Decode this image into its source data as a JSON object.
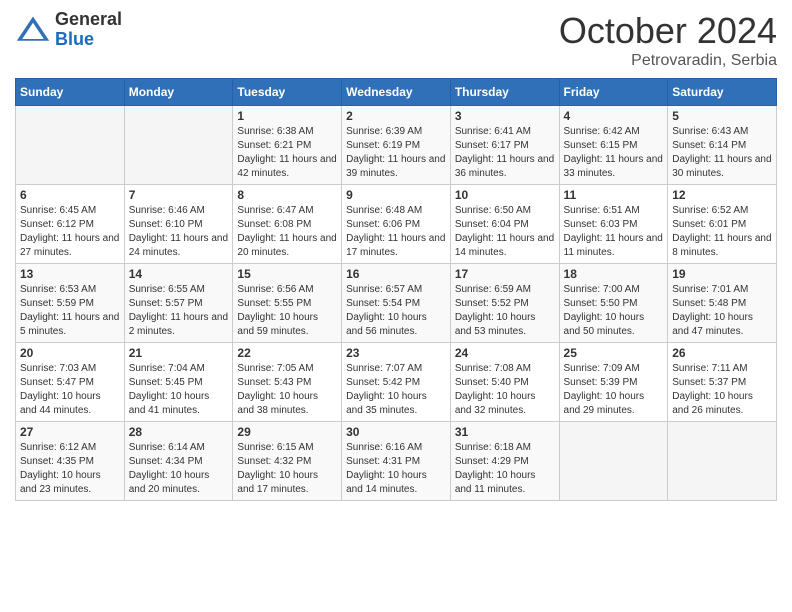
{
  "header": {
    "logo_general": "General",
    "logo_blue": "Blue",
    "month_title": "October 2024",
    "location": "Petrovaradin, Serbia"
  },
  "weekdays": [
    "Sunday",
    "Monday",
    "Tuesday",
    "Wednesday",
    "Thursday",
    "Friday",
    "Saturday"
  ],
  "weeks": [
    [
      {
        "day": "",
        "sunrise": "",
        "sunset": "",
        "daylight": ""
      },
      {
        "day": "",
        "sunrise": "",
        "sunset": "",
        "daylight": ""
      },
      {
        "day": "1",
        "sunrise": "Sunrise: 6:38 AM",
        "sunset": "Sunset: 6:21 PM",
        "daylight": "Daylight: 11 hours and 42 minutes."
      },
      {
        "day": "2",
        "sunrise": "Sunrise: 6:39 AM",
        "sunset": "Sunset: 6:19 PM",
        "daylight": "Daylight: 11 hours and 39 minutes."
      },
      {
        "day": "3",
        "sunrise": "Sunrise: 6:41 AM",
        "sunset": "Sunset: 6:17 PM",
        "daylight": "Daylight: 11 hours and 36 minutes."
      },
      {
        "day": "4",
        "sunrise": "Sunrise: 6:42 AM",
        "sunset": "Sunset: 6:15 PM",
        "daylight": "Daylight: 11 hours and 33 minutes."
      },
      {
        "day": "5",
        "sunrise": "Sunrise: 6:43 AM",
        "sunset": "Sunset: 6:14 PM",
        "daylight": "Daylight: 11 hours and 30 minutes."
      }
    ],
    [
      {
        "day": "6",
        "sunrise": "Sunrise: 6:45 AM",
        "sunset": "Sunset: 6:12 PM",
        "daylight": "Daylight: 11 hours and 27 minutes."
      },
      {
        "day": "7",
        "sunrise": "Sunrise: 6:46 AM",
        "sunset": "Sunset: 6:10 PM",
        "daylight": "Daylight: 11 hours and 24 minutes."
      },
      {
        "day": "8",
        "sunrise": "Sunrise: 6:47 AM",
        "sunset": "Sunset: 6:08 PM",
        "daylight": "Daylight: 11 hours and 20 minutes."
      },
      {
        "day": "9",
        "sunrise": "Sunrise: 6:48 AM",
        "sunset": "Sunset: 6:06 PM",
        "daylight": "Daylight: 11 hours and 17 minutes."
      },
      {
        "day": "10",
        "sunrise": "Sunrise: 6:50 AM",
        "sunset": "Sunset: 6:04 PM",
        "daylight": "Daylight: 11 hours and 14 minutes."
      },
      {
        "day": "11",
        "sunrise": "Sunrise: 6:51 AM",
        "sunset": "Sunset: 6:03 PM",
        "daylight": "Daylight: 11 hours and 11 minutes."
      },
      {
        "day": "12",
        "sunrise": "Sunrise: 6:52 AM",
        "sunset": "Sunset: 6:01 PM",
        "daylight": "Daylight: 11 hours and 8 minutes."
      }
    ],
    [
      {
        "day": "13",
        "sunrise": "Sunrise: 6:53 AM",
        "sunset": "Sunset: 5:59 PM",
        "daylight": "Daylight: 11 hours and 5 minutes."
      },
      {
        "day": "14",
        "sunrise": "Sunrise: 6:55 AM",
        "sunset": "Sunset: 5:57 PM",
        "daylight": "Daylight: 11 hours and 2 minutes."
      },
      {
        "day": "15",
        "sunrise": "Sunrise: 6:56 AM",
        "sunset": "Sunset: 5:55 PM",
        "daylight": "Daylight: 10 hours and 59 minutes."
      },
      {
        "day": "16",
        "sunrise": "Sunrise: 6:57 AM",
        "sunset": "Sunset: 5:54 PM",
        "daylight": "Daylight: 10 hours and 56 minutes."
      },
      {
        "day": "17",
        "sunrise": "Sunrise: 6:59 AM",
        "sunset": "Sunset: 5:52 PM",
        "daylight": "Daylight: 10 hours and 53 minutes."
      },
      {
        "day": "18",
        "sunrise": "Sunrise: 7:00 AM",
        "sunset": "Sunset: 5:50 PM",
        "daylight": "Daylight: 10 hours and 50 minutes."
      },
      {
        "day": "19",
        "sunrise": "Sunrise: 7:01 AM",
        "sunset": "Sunset: 5:48 PM",
        "daylight": "Daylight: 10 hours and 47 minutes."
      }
    ],
    [
      {
        "day": "20",
        "sunrise": "Sunrise: 7:03 AM",
        "sunset": "Sunset: 5:47 PM",
        "daylight": "Daylight: 10 hours and 44 minutes."
      },
      {
        "day": "21",
        "sunrise": "Sunrise: 7:04 AM",
        "sunset": "Sunset: 5:45 PM",
        "daylight": "Daylight: 10 hours and 41 minutes."
      },
      {
        "day": "22",
        "sunrise": "Sunrise: 7:05 AM",
        "sunset": "Sunset: 5:43 PM",
        "daylight": "Daylight: 10 hours and 38 minutes."
      },
      {
        "day": "23",
        "sunrise": "Sunrise: 7:07 AM",
        "sunset": "Sunset: 5:42 PM",
        "daylight": "Daylight: 10 hours and 35 minutes."
      },
      {
        "day": "24",
        "sunrise": "Sunrise: 7:08 AM",
        "sunset": "Sunset: 5:40 PM",
        "daylight": "Daylight: 10 hours and 32 minutes."
      },
      {
        "day": "25",
        "sunrise": "Sunrise: 7:09 AM",
        "sunset": "Sunset: 5:39 PM",
        "daylight": "Daylight: 10 hours and 29 minutes."
      },
      {
        "day": "26",
        "sunrise": "Sunrise: 7:11 AM",
        "sunset": "Sunset: 5:37 PM",
        "daylight": "Daylight: 10 hours and 26 minutes."
      }
    ],
    [
      {
        "day": "27",
        "sunrise": "Sunrise: 6:12 AM",
        "sunset": "Sunset: 4:35 PM",
        "daylight": "Daylight: 10 hours and 23 minutes."
      },
      {
        "day": "28",
        "sunrise": "Sunrise: 6:14 AM",
        "sunset": "Sunset: 4:34 PM",
        "daylight": "Daylight: 10 hours and 20 minutes."
      },
      {
        "day": "29",
        "sunrise": "Sunrise: 6:15 AM",
        "sunset": "Sunset: 4:32 PM",
        "daylight": "Daylight: 10 hours and 17 minutes."
      },
      {
        "day": "30",
        "sunrise": "Sunrise: 6:16 AM",
        "sunset": "Sunset: 4:31 PM",
        "daylight": "Daylight: 10 hours and 14 minutes."
      },
      {
        "day": "31",
        "sunrise": "Sunrise: 6:18 AM",
        "sunset": "Sunset: 4:29 PM",
        "daylight": "Daylight: 10 hours and 11 minutes."
      },
      {
        "day": "",
        "sunrise": "",
        "sunset": "",
        "daylight": ""
      },
      {
        "day": "",
        "sunrise": "",
        "sunset": "",
        "daylight": ""
      }
    ]
  ]
}
